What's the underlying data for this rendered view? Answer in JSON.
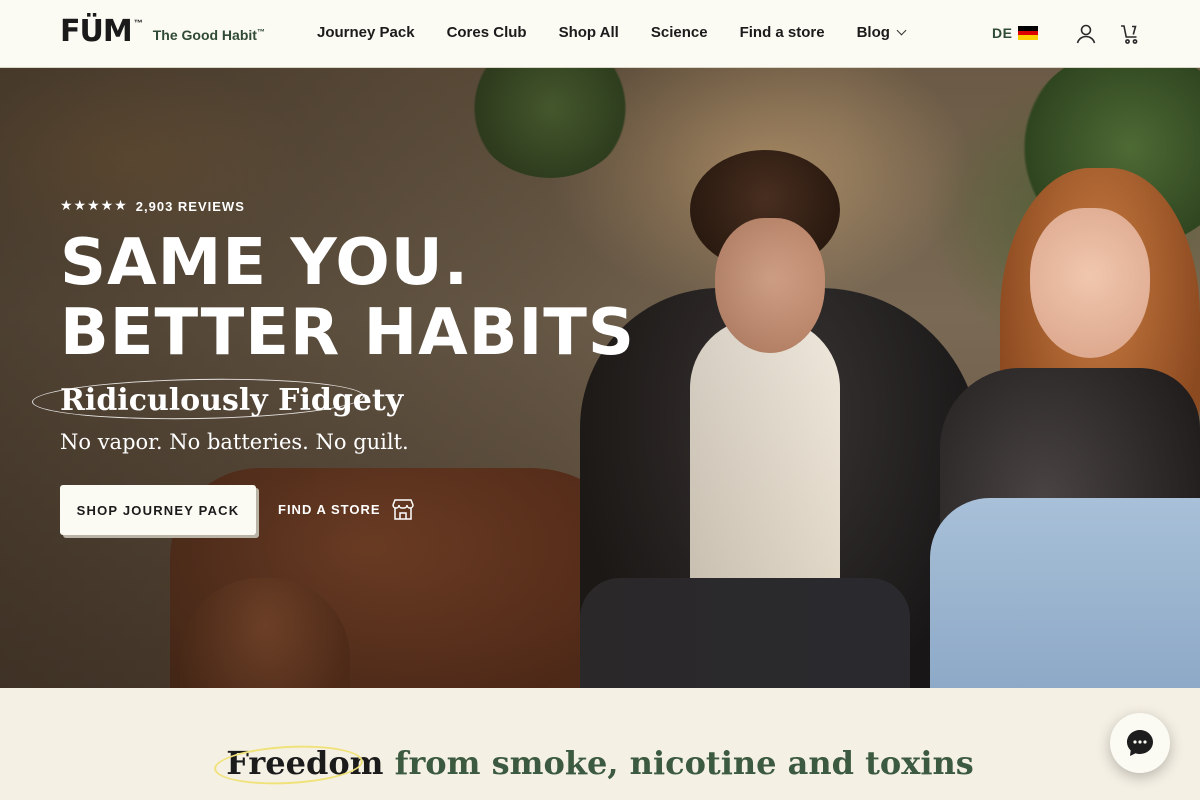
{
  "brand": {
    "logo_text": "FÜM",
    "tm": "™",
    "tagline": "The Good Habit",
    "tagline_tm": "™"
  },
  "nav": {
    "items": [
      {
        "label": "Journey Pack"
      },
      {
        "label": "Cores Club"
      },
      {
        "label": "Shop All"
      },
      {
        "label": "Science"
      },
      {
        "label": "Find a store"
      },
      {
        "label": "Blog"
      }
    ]
  },
  "locale": {
    "code": "DE",
    "flag_colors": [
      "#000000",
      "#dd0000",
      "#ffce00"
    ]
  },
  "header_icons": [
    "account-icon",
    "cart-icon"
  ],
  "hero": {
    "stars": "★★★★★",
    "reviews": "2,903 REVIEWS",
    "headline_line1": "SAME YOU.",
    "headline_line2": "BETTER HABITS",
    "subhead": "Ridiculously Fidgety",
    "tagline": "No vapor. No batteries. No guilt.",
    "cta_primary": "SHOP JOURNEY PACK",
    "cta_secondary": "FIND A STORE"
  },
  "section": {
    "highlight": "Freedom",
    "title_rest": " from smoke, nicotine and toxins"
  },
  "colors": {
    "header_bg": "#fbfaf3",
    "brand_green": "#2f4a35",
    "section_bg": "#f5f0e4",
    "highlight_ring": "#f0e27a"
  }
}
